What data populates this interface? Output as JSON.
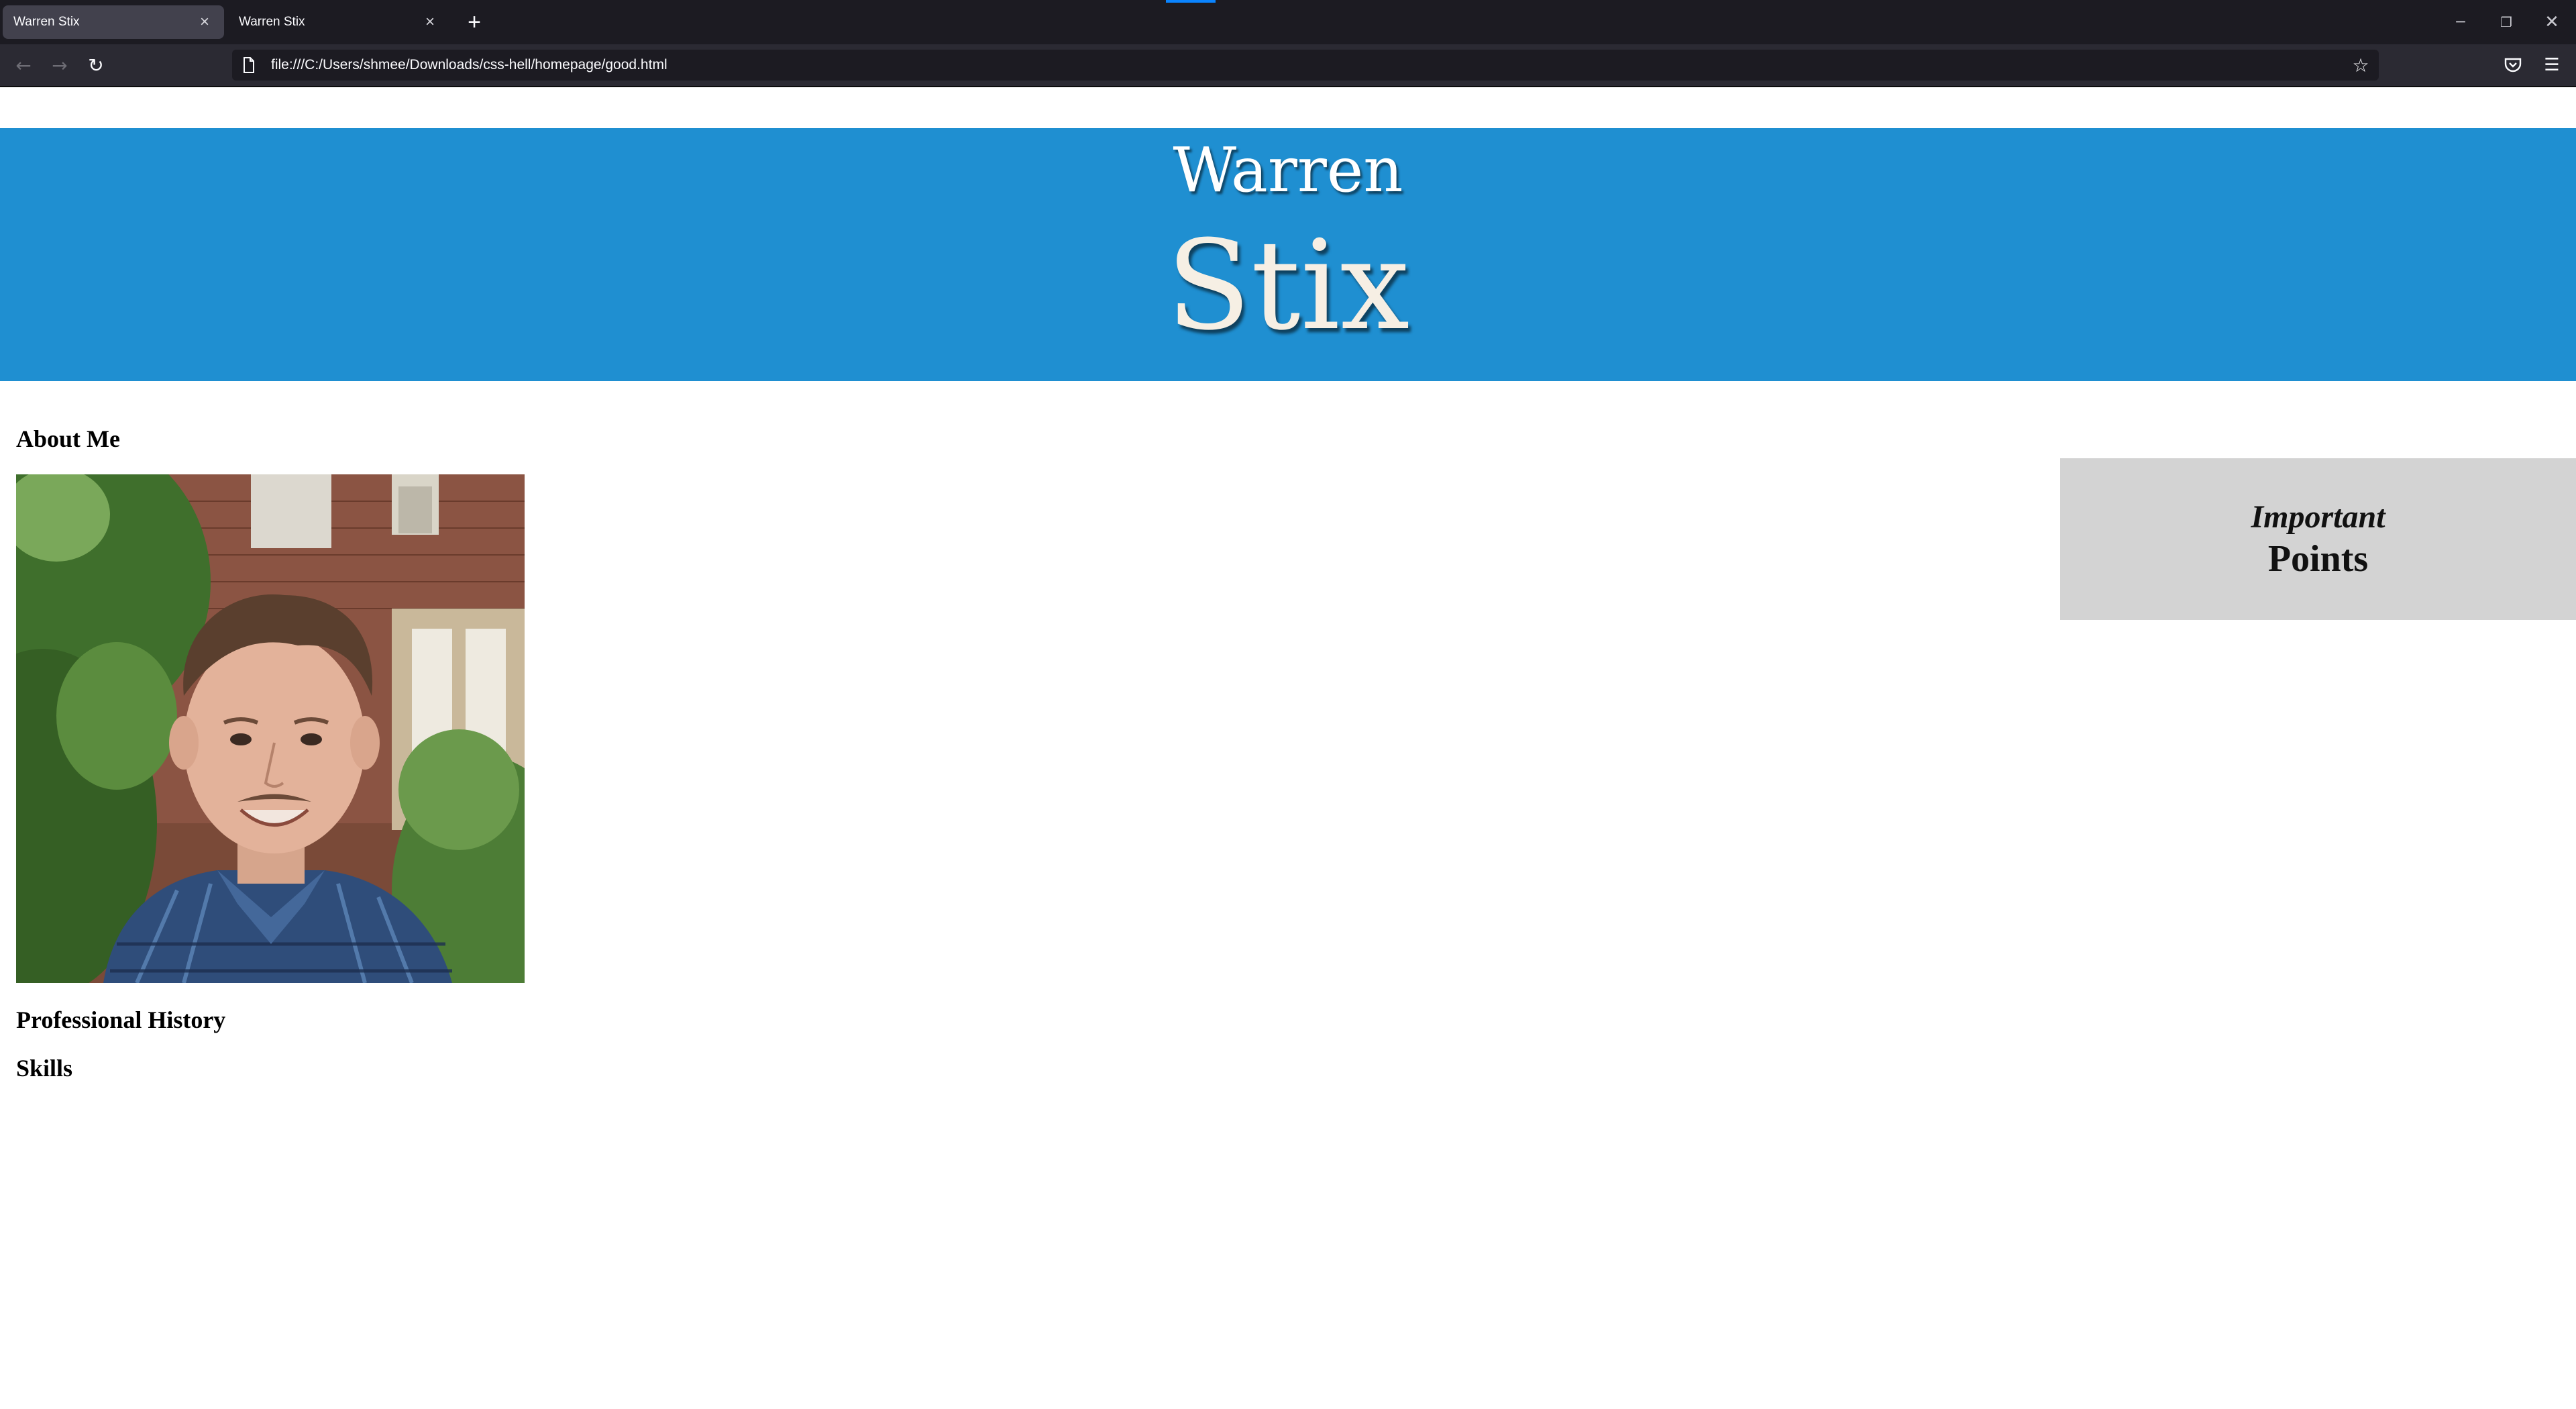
{
  "browser": {
    "tabs": [
      {
        "title": "Warren Stix",
        "active": true
      },
      {
        "title": "Warren Stix",
        "active": false
      }
    ],
    "new_tab_icon": "plus-icon",
    "url": "file:///C:/Users/shmee/Downloads/css-hell/homepage/good.html",
    "icons": {
      "back": "arrow-left-icon",
      "forward": "arrow-right-icon",
      "reload": "reload-icon",
      "page": "page-icon",
      "bookmark": "star-icon",
      "pocket": "pocket-icon",
      "menu": "hamburger-menu-icon"
    },
    "window_controls": [
      "minimize-icon",
      "restore-icon",
      "close-icon"
    ]
  },
  "page": {
    "header": {
      "first_name": "Warren",
      "last_name": "Stix",
      "background_color": "#1f8fd1"
    },
    "sections": {
      "about": "About Me",
      "history": "Professional History",
      "skills": "Skills"
    },
    "aside": {
      "line1": "Important",
      "line2": "Points",
      "background_color": "#d3d3d3"
    }
  }
}
